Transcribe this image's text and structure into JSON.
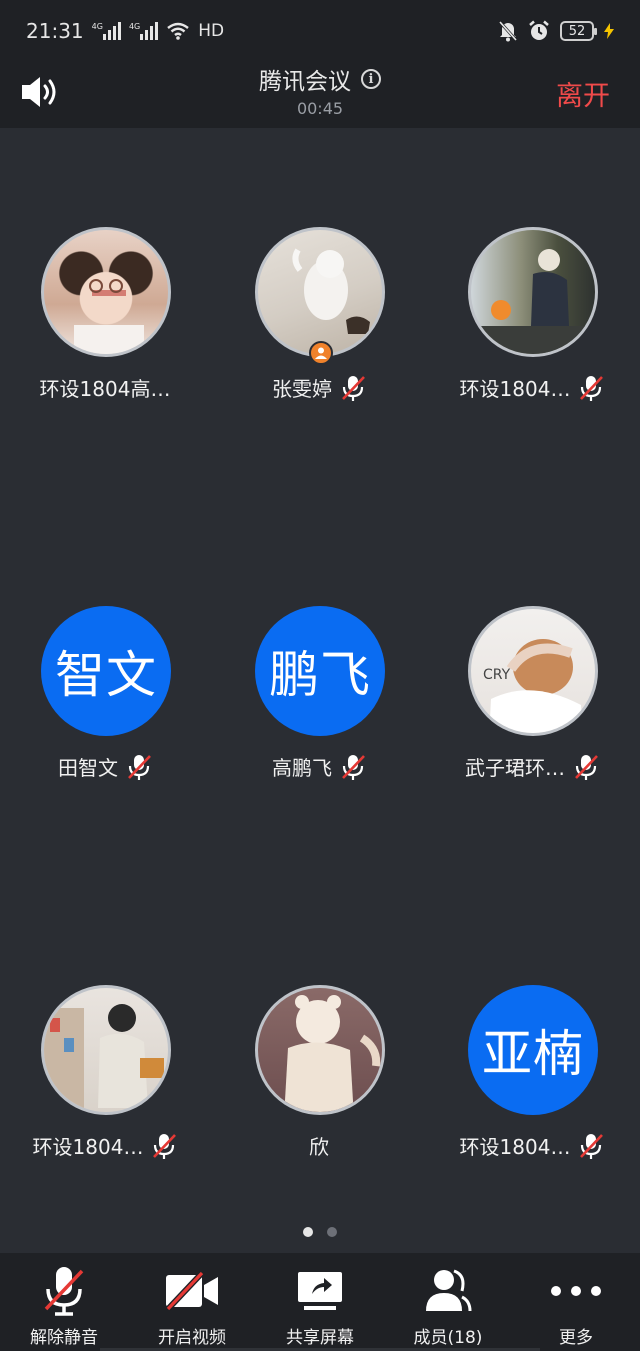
{
  "status_bar": {
    "time": "21:31",
    "network_1": "4G",
    "network_2": "4G",
    "hd": "HD",
    "battery": "52"
  },
  "header": {
    "title": "腾讯会议",
    "timer": "00:45",
    "leave_label": "离开"
  },
  "participants": [
    {
      "name": "环设1804高…",
      "avatar": "photo",
      "muted": false
    },
    {
      "name": "张雯婷",
      "avatar": "photo",
      "muted": true,
      "host": true
    },
    {
      "name": "环设1804…",
      "avatar": "photo",
      "muted": true
    },
    {
      "name": "田智文",
      "avatar_text": "智文",
      "muted": true
    },
    {
      "name": "高鹏飞",
      "avatar_text": "鹏飞",
      "muted": true
    },
    {
      "name": "武子珺环…",
      "avatar": "photo",
      "muted": true
    },
    {
      "name": "环设1804…",
      "avatar": "photo",
      "muted": true
    },
    {
      "name": "欣",
      "avatar": "photo",
      "muted": false
    },
    {
      "name": "环设1804…",
      "avatar_text": "亚楠",
      "muted": true
    }
  ],
  "pagination": {
    "pages": 2,
    "current": 1
  },
  "toolbar": {
    "unmute_label": "解除静音",
    "video_label": "开启视频",
    "share_label": "共享屏幕",
    "members_label": "成员(18)",
    "more_label": "更多"
  },
  "colors": {
    "background": "#2a2d33",
    "bar": "#1f2125",
    "accent": "#0a6cf2",
    "leave": "#f04a4a",
    "mute_slash": "#e53935",
    "host_badge": "#f0822b"
  }
}
